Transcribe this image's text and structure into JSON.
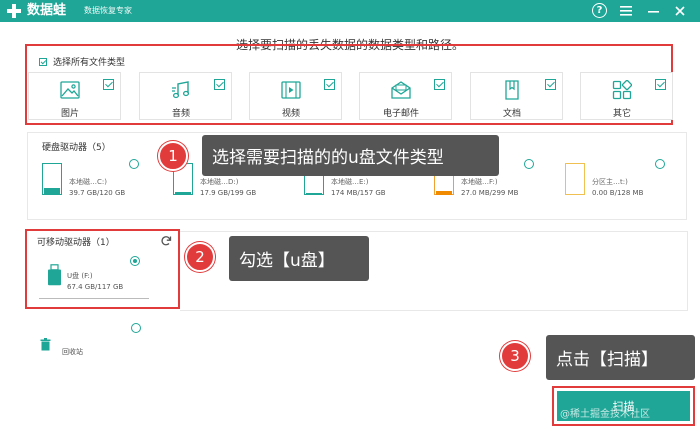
{
  "app": {
    "title": "数据蛙",
    "subtitle": "数据恢复专家",
    "icons": [
      "help-icon",
      "menu-icon",
      "minimize-icon",
      "close-icon"
    ]
  },
  "instruction": "选择要扫描的丢失数据的数据类型和路径。",
  "file_types": {
    "select_all_label": "选择所有文件类型",
    "items": [
      {
        "label": "图片",
        "icon": "image-icon",
        "checked": true
      },
      {
        "label": "音频",
        "icon": "music-icon",
        "checked": true
      },
      {
        "label": "视频",
        "icon": "video-icon",
        "checked": true
      },
      {
        "label": "电子邮件",
        "icon": "email-icon",
        "checked": true
      },
      {
        "label": "文档",
        "icon": "document-icon",
        "checked": true
      },
      {
        "label": "其它",
        "icon": "other-icon",
        "checked": true
      }
    ]
  },
  "hard_drives": {
    "title": "硬盘驱动器（5）",
    "drives": [
      {
        "name": "本地磁…C:)",
        "size": "39.7 GB/120 GB",
        "fill": 0.33
      },
      {
        "name": "本地磁…D:)",
        "size": "17.9 GB/199 GB",
        "fill": 0.09
      },
      {
        "name": "本地磁…E:)",
        "size": "174 MB/157 GB",
        "fill": 0.01
      },
      {
        "name": "本地磁…F:)",
        "size": "27.0 MB/299 MB",
        "fill": 0.09
      },
      {
        "name": "分区主…t:)",
        "size": "0.00  B/128 MB",
        "fill": 0.0
      }
    ]
  },
  "removable": {
    "title": "可移动驱动器（1）",
    "drive_name": "U盘 (F:)",
    "drive_size": "67.4 GB/117 GB",
    "selected": true
  },
  "recycle_bin": {
    "label": "回收站"
  },
  "callouts": [
    {
      "number": "1",
      "text": "选择需要扫描的的u盘文件类型"
    },
    {
      "number": "2",
      "text": "勾选【u盘】"
    },
    {
      "number": "3",
      "text": "点击【扫描】"
    }
  ],
  "scan_button": "扫描",
  "watermark": "@稀土掘金技术社区",
  "colors": {
    "accent": "#1fa697",
    "highlight": "#e23b3b",
    "callout": "#555555"
  }
}
